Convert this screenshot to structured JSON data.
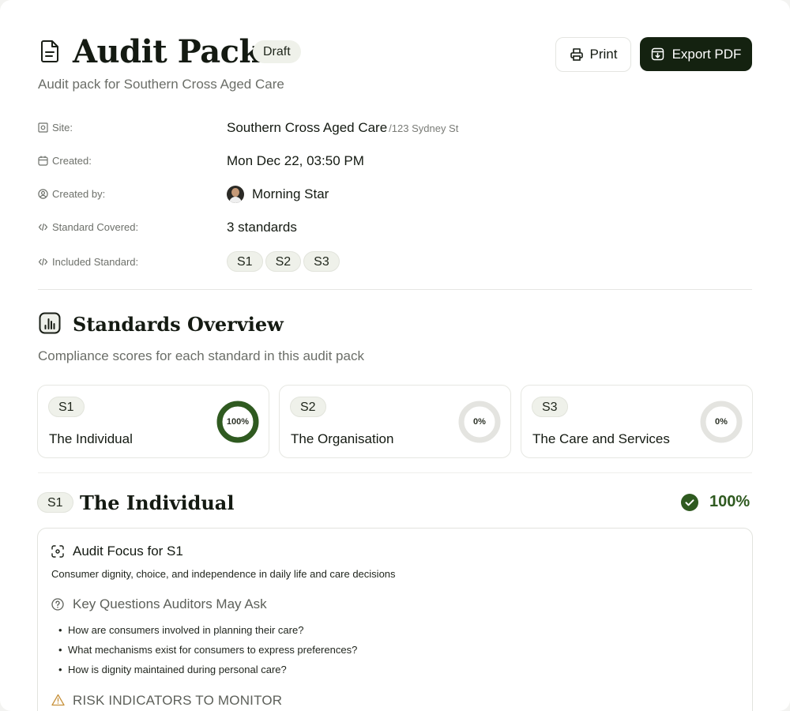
{
  "header": {
    "title": "Audit Pack",
    "status": "Draft",
    "subtitle": "Audit pack for Southern Cross Aged Care",
    "print_label": "Print",
    "export_label": "Export PDF"
  },
  "meta": {
    "site_label": "Site:",
    "site_value": "Southern  Cross Aged Care",
    "site_address": "/123 Sydney St",
    "created_label": "Created:",
    "created_value": "Mon Dec 22, 03:50 PM",
    "created_by_label": "Created by:",
    "created_by_value": "Morning Star",
    "covered_label": "Standard Covered:",
    "covered_value": "3 standards",
    "included_label": "Included Standard:",
    "included": [
      "S1",
      "S2",
      "S3"
    ]
  },
  "overview": {
    "title": "Standards Overview",
    "subtitle": "Compliance scores for each standard in this audit pack",
    "cards": [
      {
        "code": "S1",
        "name": "The Individual",
        "percent": 100,
        "label": "100%"
      },
      {
        "code": "S2",
        "name": "The Organisation",
        "percent": 0,
        "label": "0%"
      },
      {
        "code": "S3",
        "name": "The Care and Services",
        "percent": 0,
        "label": "0%"
      }
    ]
  },
  "section": {
    "code": "S1",
    "title": "The Individual",
    "percent_label": "100%",
    "focus_title": "Audit Focus for S1",
    "focus_desc": "Consumer dignity, choice, and independence in daily life and care decisions",
    "questions_title": "Key Questions Auditors May Ask",
    "questions": [
      "How are consumers involved in planning their care?",
      "What mechanisms exist for consumers to express preferences?",
      "How is dignity maintained during personal care?"
    ],
    "risk_title": "RISK INDICATORS TO MONITOR"
  },
  "colors": {
    "accent_dark": "#142210",
    "success": "#2f5a20",
    "ring_track": "#e4e4e0",
    "chip_bg": "#eff1ea"
  }
}
